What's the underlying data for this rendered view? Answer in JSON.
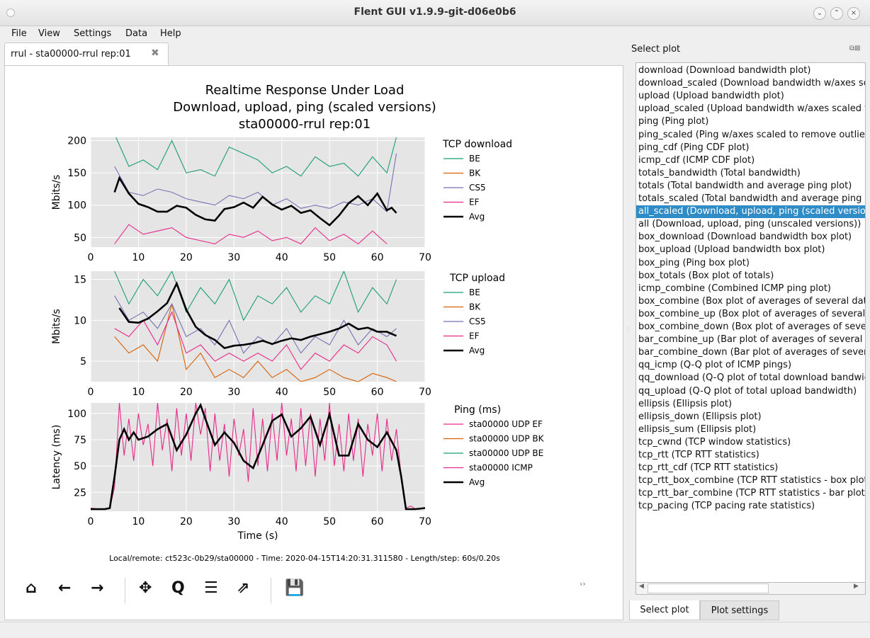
{
  "window": {
    "title": "Flent GUI v1.9.9-git-d06e0b6"
  },
  "menu": [
    "File",
    "View",
    "Settings",
    "Data",
    "Help"
  ],
  "tab": {
    "label": "rrul - sta00000-rrul rep:01",
    "close_icon": "close-icon"
  },
  "figure": {
    "title_lines": [
      "Realtime Response Under Load",
      "Download, upload, ping (scaled versions)",
      "sta00000-rrul rep:01"
    ],
    "footer": "Local/remote: ct523c-0b29/sta00000 - Time: 2020-04-15T14:20:31.311580 - Length/step: 60s/0.20s",
    "xlabel": "Time (s)",
    "colors": {
      "BE": "#1b9e77",
      "BK": "#d95f02",
      "CS5": "#7570b3",
      "EF": "#e7298a",
      "Avg": "#000000",
      "grid_bg": "#e5e5e5"
    }
  },
  "chart_data": [
    {
      "type": "line",
      "ylabel": "Mbits/s",
      "legend_title": "TCP download",
      "xlim": [
        0,
        70
      ],
      "ylim": [
        35,
        205
      ],
      "x_ticks": [
        0,
        10,
        20,
        30,
        40,
        50,
        60,
        70
      ],
      "y_ticks": [
        50,
        100,
        150,
        200
      ],
      "series": [
        {
          "name": "BE",
          "x": [
            5,
            8,
            11,
            14,
            17,
            20,
            23,
            26,
            29,
            32,
            35,
            38,
            41,
            44,
            47,
            50,
            53,
            56,
            59,
            62,
            64
          ],
          "values": [
            210,
            160,
            170,
            155,
            200,
            150,
            155,
            145,
            190,
            180,
            170,
            150,
            160,
            145,
            175,
            160,
            165,
            145,
            175,
            150,
            205
          ]
        },
        {
          "name": "BK",
          "x": [],
          "values": []
        },
        {
          "name": "CS5",
          "x": [
            5,
            8,
            11,
            14,
            17,
            20,
            23,
            26,
            29,
            32,
            35,
            38,
            41,
            44,
            47,
            50,
            53,
            56,
            59,
            62,
            64
          ],
          "values": [
            160,
            120,
            115,
            125,
            120,
            110,
            105,
            100,
            115,
            110,
            120,
            100,
            110,
            95,
            100,
            95,
            105,
            100,
            110,
            90,
            180
          ]
        },
        {
          "name": "EF",
          "x": [
            5,
            8,
            11,
            14,
            17,
            20,
            23,
            26,
            29,
            32,
            35,
            38,
            41,
            44,
            47,
            50,
            53,
            56,
            59,
            62
          ],
          "values": [
            40,
            70,
            55,
            60,
            65,
            50,
            45,
            40,
            55,
            50,
            60,
            45,
            50,
            40,
            65,
            45,
            55,
            40,
            60,
            40
          ]
        },
        {
          "name": "Avg",
          "x": [
            5,
            6,
            8,
            10,
            12,
            14,
            16,
            18,
            20,
            22,
            24,
            26,
            28,
            30,
            32,
            34,
            36,
            38,
            40,
            42,
            44,
            46,
            48,
            50,
            52,
            54,
            56,
            58,
            60,
            62,
            63,
            64
          ],
          "values": [
            120,
            142,
            118,
            102,
            97,
            90,
            90,
            99,
            96,
            85,
            78,
            76,
            94,
            97,
            104,
            96,
            113,
            101,
            93,
            99,
            88,
            92,
            80,
            69,
            84,
            103,
            114,
            100,
            118,
            92,
            96,
            88
          ]
        }
      ]
    },
    {
      "type": "line",
      "ylabel": "Mbits/s",
      "legend_title": "TCP upload",
      "xlim": [
        0,
        70
      ],
      "ylim": [
        2.5,
        16
      ],
      "x_ticks": [
        0,
        10,
        20,
        30,
        40,
        50,
        60,
        70
      ],
      "y_ticks": [
        5,
        10,
        15
      ],
      "series": [
        {
          "name": "BE",
          "x": [
            5,
            8,
            11,
            14,
            17,
            20,
            23,
            26,
            29,
            32,
            35,
            38,
            41,
            44,
            47,
            50,
            53,
            56,
            59,
            62,
            64
          ],
          "values": [
            16,
            12,
            15,
            13,
            16,
            11,
            14,
            12,
            15,
            10,
            13,
            12,
            14,
            11,
            13,
            12,
            16,
            11,
            14,
            12,
            15
          ]
        },
        {
          "name": "BK",
          "x": [
            5,
            8,
            11,
            14,
            17,
            20,
            23,
            26,
            29,
            32,
            35,
            38,
            41,
            44,
            47,
            50,
            53,
            56,
            59,
            62,
            64
          ],
          "values": [
            8,
            6,
            7,
            5,
            12,
            4,
            6,
            3,
            4,
            3,
            5,
            3,
            4,
            2.5,
            3,
            4,
            3,
            2.5,
            3.5,
            3,
            2.5
          ]
        },
        {
          "name": "CS5",
          "x": [
            5,
            8,
            11,
            14,
            17,
            20,
            23,
            26,
            29,
            32,
            35,
            38,
            41,
            44,
            47,
            50,
            53,
            56,
            59,
            62,
            64
          ],
          "values": [
            13,
            10,
            11,
            9,
            12,
            8,
            9,
            7,
            10,
            6,
            8,
            7,
            9,
            6,
            8,
            7,
            10,
            7,
            9,
            8,
            9
          ]
        },
        {
          "name": "EF",
          "x": [
            5,
            8,
            11,
            14,
            17,
            20,
            23,
            26,
            29,
            32,
            35,
            38,
            41,
            44,
            47,
            50,
            53,
            56,
            59,
            62,
            64
          ],
          "values": [
            9,
            8,
            10,
            7,
            11,
            6,
            7,
            5,
            6,
            5,
            6,
            5,
            7,
            4,
            6,
            5,
            7,
            6,
            8,
            7,
            5
          ]
        },
        {
          "name": "Avg",
          "x": [
            6,
            8,
            10,
            12,
            14,
            16,
            18,
            20,
            22,
            24,
            26,
            28,
            30,
            32,
            34,
            36,
            38,
            40,
            42,
            44,
            46,
            48,
            50,
            52,
            54,
            56,
            58,
            60,
            62,
            64
          ],
          "values": [
            11.5,
            9.8,
            9.7,
            10.2,
            11.1,
            12.1,
            14.5,
            11.3,
            9.2,
            8.2,
            7.6,
            6.6,
            6.9,
            7.0,
            7.2,
            7.5,
            7.1,
            7.5,
            7.8,
            7.6,
            8.0,
            8.3,
            8.6,
            9.0,
            9.6,
            8.9,
            9.1,
            8.6,
            8.6,
            8.1
          ]
        }
      ]
    },
    {
      "type": "line",
      "ylabel": "Latency (ms)",
      "legend_title": "Ping (ms)",
      "xlim": [
        0,
        70
      ],
      "ylim": [
        7,
        110
      ],
      "x_ticks": [
        0,
        10,
        20,
        30,
        40,
        50,
        60,
        70
      ],
      "y_ticks": [
        25,
        50,
        75,
        100
      ],
      "series": [
        {
          "name": "sta00000 UDP EF",
          "x": [],
          "values": []
        },
        {
          "name": "sta00000 UDP BK",
          "x": [],
          "values": []
        },
        {
          "name": "sta00000 UDP BE",
          "x": [],
          "values": []
        },
        {
          "name": "sta00000 ICMP",
          "x": [
            0,
            2,
            4,
            5,
            6,
            7,
            8,
            9,
            10,
            11,
            12,
            13,
            14,
            15,
            16,
            17,
            18,
            19,
            20,
            21,
            22,
            23,
            24,
            25,
            26,
            27,
            28,
            29,
            30,
            31,
            32,
            33,
            34,
            35,
            36,
            37,
            38,
            39,
            40,
            41,
            42,
            43,
            44,
            45,
            46,
            47,
            48,
            49,
            50,
            51,
            52,
            53,
            54,
            55,
            56,
            57,
            58,
            59,
            60,
            61,
            62,
            63,
            64,
            65,
            66,
            67,
            68,
            70
          ],
          "values": [
            10,
            9,
            10,
            30,
            110,
            60,
            95,
            55,
            100,
            70,
            90,
            50,
            110,
            65,
            95,
            45,
            105,
            60,
            100,
            55,
            110,
            80,
            105,
            45,
            100,
            55,
            90,
            40,
            95,
            60,
            85,
            35,
            105,
            50,
            95,
            45,
            100,
            55,
            110,
            60,
            95,
            45,
            105,
            50,
            100,
            40,
            95,
            55,
            110,
            50,
            90,
            45,
            100,
            55,
            95,
            40,
            90,
            60,
            100,
            45,
            95,
            55,
            85,
            40,
            10,
            12,
            9,
            10
          ]
        },
        {
          "name": "Avg",
          "x": [
            0,
            3,
            4,
            5,
            6,
            7,
            8,
            9,
            10,
            12,
            14,
            16,
            18,
            20,
            22,
            23,
            24,
            26,
            28,
            30,
            32,
            34,
            36,
            38,
            40,
            42,
            44,
            46,
            48,
            50,
            52,
            54,
            56,
            58,
            60,
            62,
            64,
            65,
            66,
            68,
            70
          ],
          "values": [
            9,
            9,
            10,
            40,
            75,
            85,
            75,
            82,
            75,
            78,
            85,
            90,
            65,
            80,
            100,
            108,
            95,
            70,
            82,
            72,
            55,
            48,
            70,
            93,
            99,
            78,
            86,
            97,
            70,
            99,
            60,
            60,
            90,
            75,
            68,
            82,
            65,
            40,
            9,
            9,
            10
          ]
        }
      ]
    }
  ],
  "toolbar": [
    {
      "name": "home-icon",
      "glyph": "⌂"
    },
    {
      "name": "back-icon",
      "glyph": "←"
    },
    {
      "name": "forward-icon",
      "glyph": "→"
    },
    {
      "name": "pan-icon",
      "glyph": "✥"
    },
    {
      "name": "zoom-icon",
      "glyph": "Q"
    },
    {
      "name": "configure-subplots-icon",
      "glyph": "☰"
    },
    {
      "name": "edit-axes-icon",
      "glyph": "⇗"
    },
    {
      "name": "save-icon",
      "glyph": "💾"
    }
  ],
  "overflow_glyph": "››",
  "sidebar": {
    "title": "Select plot",
    "selected_index": 12,
    "items": [
      "download (Download bandwidth plot)",
      "download_scaled (Download bandwidth w/axes scaled",
      "upload (Upload bandwidth plot)",
      "upload_scaled (Upload bandwidth w/axes scaled to r",
      "ping (Ping plot)",
      "ping_scaled (Ping w/axes scaled to remove outliers)",
      "ping_cdf (Ping CDF plot)",
      "icmp_cdf (ICMP CDF plot)",
      "totals_bandwidth (Total bandwidth)",
      "totals (Total bandwidth and average ping plot)",
      "totals_scaled (Total bandwidth and average ping plot",
      "all_scaled (Download, upload, ping (scaled versions))",
      "all (Download, upload, ping (unscaled versions))",
      "box_download (Download bandwidth box plot)",
      "box_upload (Upload bandwidth box plot)",
      "box_ping (Ping box plot)",
      "box_totals (Box plot of totals)",
      "icmp_combine (Combined ICMP ping plot)",
      "box_combine (Box plot of averages of several data",
      "box_combine_up (Box plot of averages of several d",
      "box_combine_down (Box plot of averages of several",
      "bar_combine_up (Bar plot of averages of several da",
      "bar_combine_down (Bar plot of averages of several",
      "qq_icmp (Q-Q plot of ICMP pings)",
      "qq_download (Q-Q plot of total download bandwidth",
      "qq_upload (Q-Q plot of total upload bandwidth)",
      "ellipsis (Ellipsis plot)",
      "ellipsis_down (Ellipsis plot)",
      "ellipsis_sum (Ellipsis plot)",
      "tcp_cwnd (TCP window statistics)",
      "tcp_rtt (TCP RTT statistics)",
      "tcp_rtt_cdf (TCP RTT statistics)",
      "tcp_rtt_box_combine (TCP RTT statistics - box plot)",
      "tcp_rtt_bar_combine (TCP RTT statistics - bar plot)",
      "tcp_pacing (TCP pacing rate statistics)"
    ],
    "tabs": [
      "Select plot",
      "Plot settings"
    ]
  }
}
